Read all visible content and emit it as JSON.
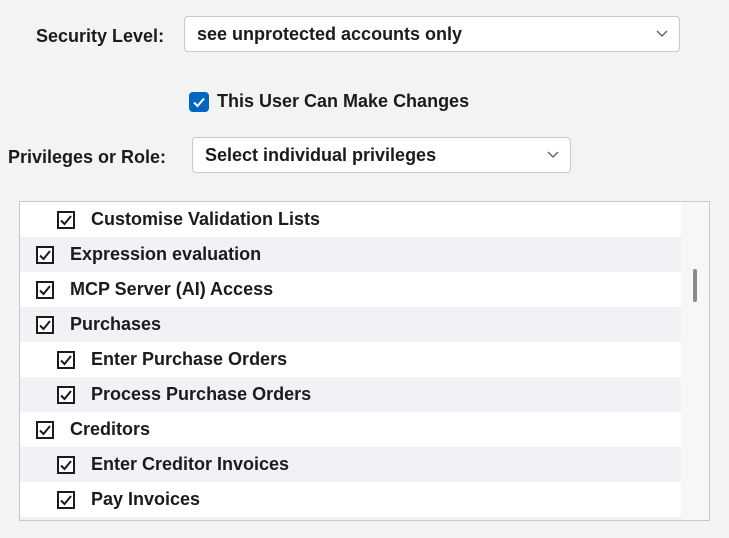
{
  "security_level": {
    "label": "Security Level:",
    "value": "see unprotected accounts only"
  },
  "user_can_make_changes": {
    "label": "This User Can Make Changes",
    "checked": true
  },
  "privileges": {
    "label": "Privileges or Role:",
    "value": "Select individual privileges"
  },
  "privilege_list": [
    {
      "label": "Customise Validation Lists",
      "checked": true,
      "level": 1
    },
    {
      "label": "Expression evaluation",
      "checked": true,
      "level": 0
    },
    {
      "label": "MCP Server (AI) Access",
      "checked": true,
      "level": 0
    },
    {
      "label": "Purchases",
      "checked": true,
      "level": 0
    },
    {
      "label": "Enter Purchase Orders",
      "checked": true,
      "level": 1
    },
    {
      "label": "Process Purchase Orders",
      "checked": true,
      "level": 1
    },
    {
      "label": "Creditors",
      "checked": true,
      "level": 0
    },
    {
      "label": "Enter Creditor Invoices",
      "checked": true,
      "level": 1
    },
    {
      "label": "Pay Invoices",
      "checked": true,
      "level": 1
    }
  ],
  "colors": {
    "accent": "#0067c0",
    "row_alt": "#f0f2f6"
  }
}
